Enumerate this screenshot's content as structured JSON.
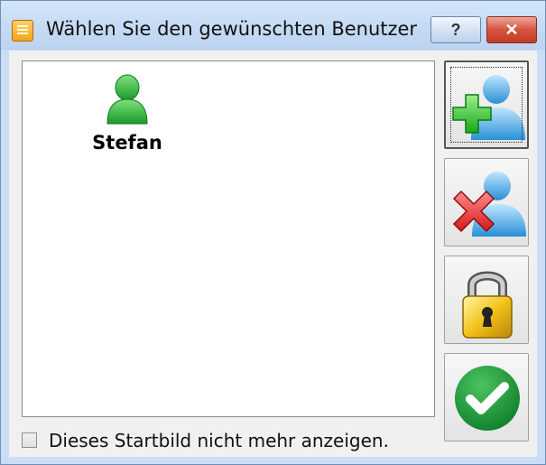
{
  "window": {
    "title": "Wählen Sie den gewünschten Benutzer",
    "help_label": "?",
    "close_label": "✕"
  },
  "users": [
    {
      "name": "Stefan",
      "icon": "user-icon"
    }
  ],
  "actions": [
    {
      "name": "add-user-button",
      "icon": "add-user-icon"
    },
    {
      "name": "remove-user-button",
      "icon": "remove-user-icon"
    },
    {
      "name": "lock-button",
      "icon": "padlock-icon"
    },
    {
      "name": "confirm-button",
      "icon": "checkmark-icon"
    }
  ],
  "options": {
    "hide_startscreen_label": "Dieses Startbild nicht mehr anzeigen.",
    "hide_startscreen_checked": false
  }
}
